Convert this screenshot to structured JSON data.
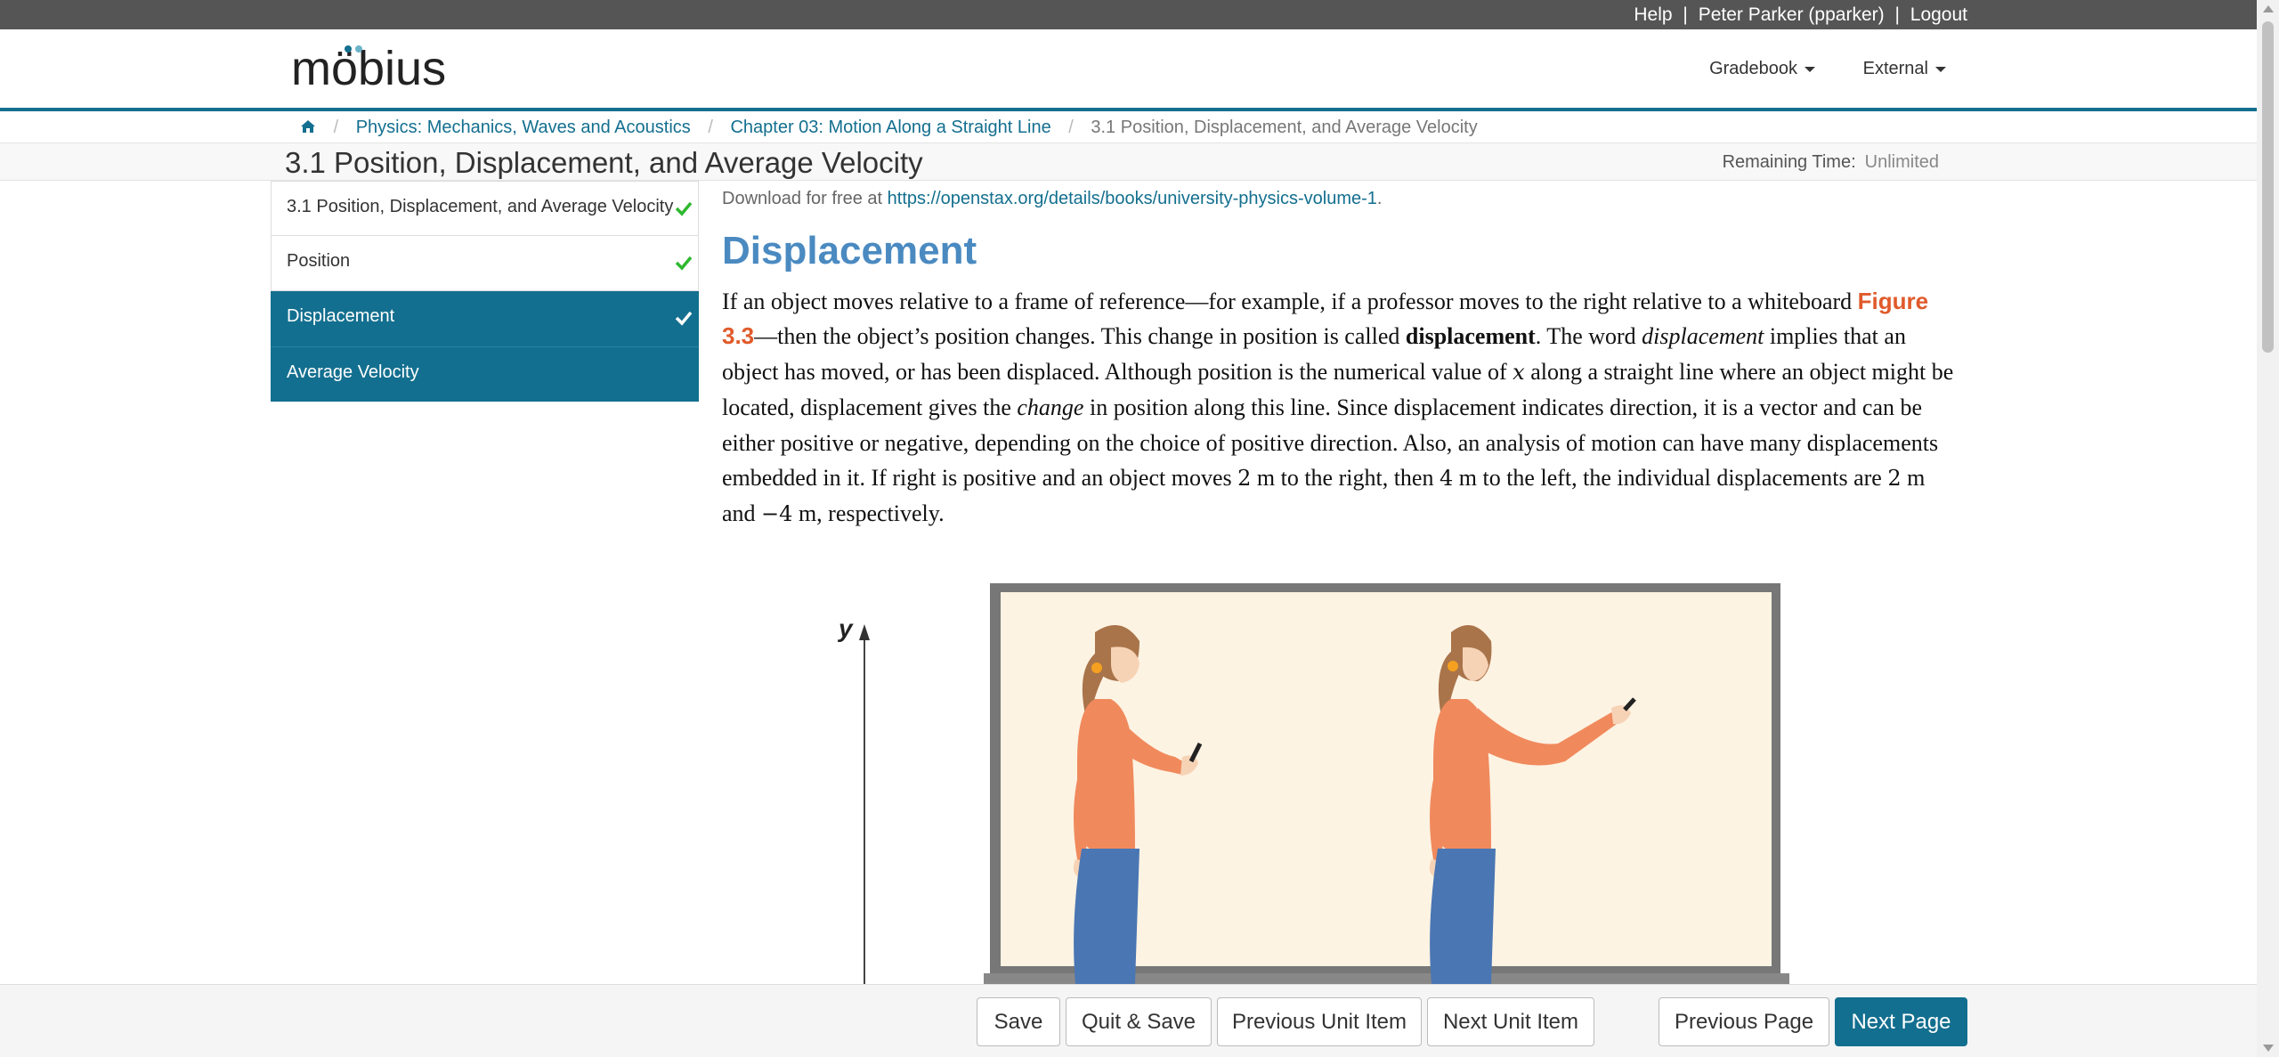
{
  "topbar": {
    "help": "Help",
    "user": "Peter Parker (pparker)",
    "logout": "Logout",
    "separator": "|"
  },
  "header": {
    "logo_text": "möbius",
    "menus": [
      {
        "label": "Gradebook"
      },
      {
        "label": "External"
      }
    ]
  },
  "breadcrumb": {
    "home_icon": "home-icon",
    "items": [
      "Physics: Mechanics, Waves and Acoustics",
      "Chapter 03: Motion Along a Straight Line",
      "3.1 Position, Displacement, and Average Velocity"
    ],
    "separator": "/"
  },
  "title_row": {
    "title": "3.1 Position, Displacement, and Average Velocity",
    "remaining_label": "Remaining Time:",
    "remaining_value": "Unlimited"
  },
  "sidebar": {
    "items": [
      {
        "label": "3.1 Position, Displacement, and Average Velocity",
        "completed": true,
        "state": "visited"
      },
      {
        "label": "Position",
        "completed": true,
        "state": "visited"
      },
      {
        "label": "Displacement",
        "completed": true,
        "state": "active"
      },
      {
        "label": "Average Velocity",
        "completed": false,
        "state": "unvisited"
      }
    ]
  },
  "content": {
    "download_prefix": "Download for free at ",
    "download_link": "https://openstax.org/details/books/university-physics-volume-1",
    "download_suffix": ".",
    "heading": "Displacement",
    "p1": "If an object moves relative to a frame of reference—for example, if a professor moves to the right relative to a whiteboard ",
    "figure_ref": "Figure 3.3",
    "p2": "—then the object’s position changes. This change in position is called ",
    "bold_term": "displacement",
    "p3": ". The word ",
    "italic_term": "displacement",
    "p4": " implies that an object has moved, or has been displaced. Although position is the numerical value of ",
    "math_x": "x",
    "p5": " along a straight line where an object might be located, displacement gives the ",
    "italic_change": "change",
    "p6": " in position along this line. Since displacement indicates direction, it is a vector and can be either positive or negative, depending on the choice of positive direction. Also, an analysis of motion can have many displacements embedded in it. If right is positive and an object moves ",
    "math_2a": "2",
    "unit_m1": " m to the right, then ",
    "math_4": "4",
    "unit_m2": " m to the left, the individual displacements are ",
    "math_2b": "2",
    "unit_m3": " m and ",
    "math_neg4": "−4",
    "unit_m4": " m, respectively."
  },
  "figure": {
    "axis_label": "y"
  },
  "footer": {
    "save": "Save",
    "quit_save": "Quit & Save",
    "prev_unit": "Previous Unit Item",
    "next_unit": "Next Unit Item",
    "prev_page": "Previous Page",
    "next_page": "Next Page"
  },
  "colors": {
    "primary": "#136f8f",
    "heading": "#4a8ac1",
    "figure_ref": "#e05a2b",
    "check": "#2eb82e"
  }
}
